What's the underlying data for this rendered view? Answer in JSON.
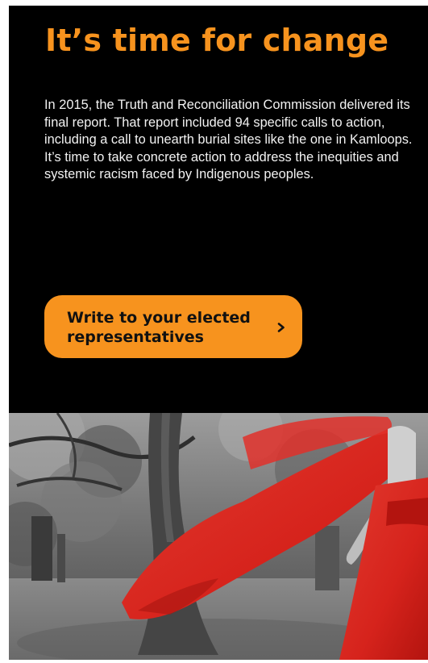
{
  "hero": {
    "title": "It’s time for change",
    "body": "In 2015, the Truth and Reconciliation Commission delivered its final report. That report included 94 specific calls to action, including a call to unearth burial sites like the one in Kamloops. It’s time to take concrete action to address the inequities and systemic racism faced by Indigenous peoples.",
    "cta_label": "Write to your elected representatives"
  },
  "colors": {
    "accent": "#f7931e",
    "background": "#000000",
    "text": "#f2f2f2",
    "dress": "#d6231c"
  },
  "icons": {
    "cta": "chevron-right-icon"
  }
}
